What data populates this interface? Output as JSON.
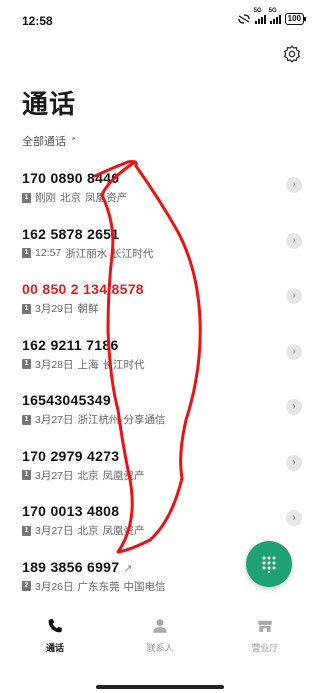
{
  "status_bar": {
    "time": "12:58",
    "sim1_label": "5G",
    "sim2_label": "5G",
    "battery": "100"
  },
  "page": {
    "title": "通话",
    "filter_label": "全部通话"
  },
  "calls": [
    {
      "number": "170 0890 8440",
      "sim": "1",
      "time": "刚刚",
      "location": "北京",
      "carrier": "凤凰资产",
      "missed": false
    },
    {
      "number": "162 5878 2651",
      "sim": "1",
      "time": "12:57",
      "location": "浙江丽水",
      "carrier": "长江时代",
      "missed": false
    },
    {
      "number": "00 850 2 134 8578",
      "sim": "1",
      "time": "3月29日",
      "location": "朝鲜",
      "carrier": "",
      "missed": true
    },
    {
      "number": "162 9211 7186",
      "sim": "1",
      "time": "3月28日",
      "location": "上海",
      "carrier": "长江时代",
      "missed": false
    },
    {
      "number": "16543045349",
      "sim": "1",
      "time": "3月27日",
      "location": "浙江杭州",
      "carrier": "分享通信",
      "missed": false
    },
    {
      "number": "170 2979 4273",
      "sim": "1",
      "time": "3月27日",
      "location": "北京",
      "carrier": "凤凰资产",
      "missed": false
    },
    {
      "number": "170 0013 4808",
      "sim": "1",
      "time": "3月27日",
      "location": "北京",
      "carrier": "凤凰资产",
      "missed": false
    },
    {
      "number": "189 3856 6997",
      "sim": "2",
      "time": "3月26日",
      "location": "广东东莞",
      "carrier": "中国电信",
      "missed": false
    }
  ],
  "tabs": [
    {
      "label": "通话",
      "icon": "phone-icon",
      "active": true
    },
    {
      "label": "联系人",
      "icon": "person-icon",
      "active": false
    },
    {
      "label": "营业厅",
      "icon": "store-icon",
      "active": false
    }
  ],
  "colors": {
    "accent": "#1fa176",
    "missed": "#e02020",
    "annotation": "#ee1111"
  }
}
